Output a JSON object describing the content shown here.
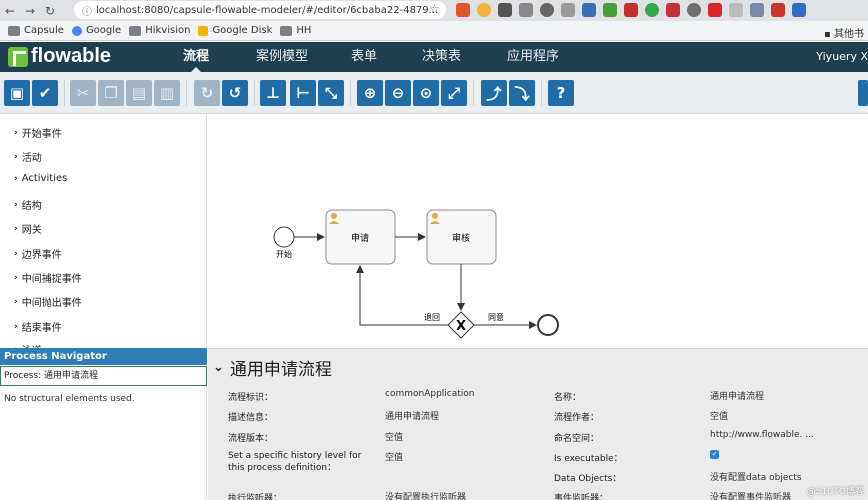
{
  "browser": {
    "url": "localhost:8080/capsule-flowable-modeler/#/editor/6cbaba22-4879...",
    "bookmarks": [
      "Capsule",
      "Google",
      "Hikvision",
      "Google Disk",
      "HH"
    ],
    "other_bookmarks": "其他书"
  },
  "app": {
    "logo_text": "flowable",
    "menu": [
      "流程",
      "案例模型",
      "表单",
      "决策表",
      "应用程序"
    ],
    "active_menu": "流程",
    "user": "Yiyuery X"
  },
  "palette": {
    "items": [
      "开始事件",
      "活动",
      "Activities",
      "结构",
      "网关",
      "边界事件",
      "中间捕捉事件",
      "中间抛出事件",
      "结束事件",
      "泳道"
    ]
  },
  "navigator": {
    "title": "Process Navigator",
    "process_label": "Process: 通用申请流程",
    "empty_text": "No structural elements used."
  },
  "diagram": {
    "start_label": "开始",
    "task1": "申请",
    "task2": "审核",
    "reject_label": "退回",
    "approve_label": "同意",
    "gateway_symbol": "X"
  },
  "properties": {
    "title": "通用申请流程",
    "rows": [
      {
        "label": "流程标识：",
        "value": "commonApplication"
      },
      {
        "label": "描述信息：",
        "value": "通用申请流程"
      },
      {
        "label": "流程版本：",
        "value": "空值"
      },
      {
        "label": "Set a specific history level for this process definition：",
        "value": "空值"
      },
      {
        "label": "执行监听器：",
        "value": "没有配置执行监听器"
      }
    ],
    "rows_right": [
      {
        "label": "名称：",
        "value": "通用申请流程"
      },
      {
        "label": "流程作者：",
        "value": "空值"
      },
      {
        "label": "命名空间：",
        "value": "http://www.flowable. ..."
      },
      {
        "label": "Is executable：",
        "value": ""
      },
      {
        "label": "Data Objects：",
        "value": "没有配置data objects"
      },
      {
        "label": "事件监听器：",
        "value": "没有配置事件监听器"
      }
    ]
  },
  "watermark": "@51CTO博客",
  "colors": {
    "app_header": "#1e3f4f",
    "toolbar_button": "#1f6ca6",
    "navigator_header": "#2e7db6",
    "logo_green": "#6fbf3f"
  }
}
